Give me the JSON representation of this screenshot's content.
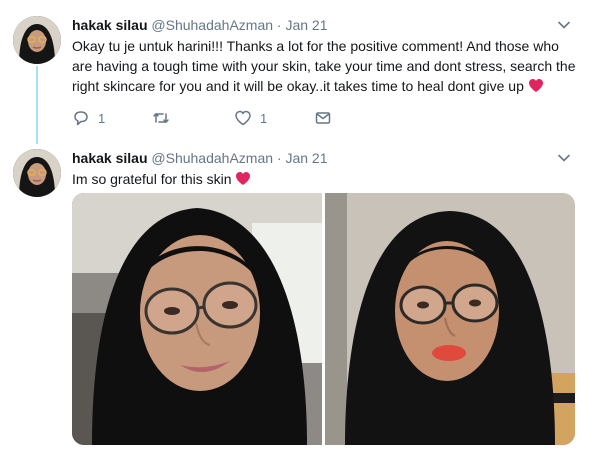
{
  "tweets": [
    {
      "name": "hakak silau",
      "handle": "@ShuhadahAzman",
      "separator": "·",
      "time": "Jan 21",
      "text": "Okay tu je untuk harini!!! Thanks a lot for the positive comment! And those who are having a tough time with your skin, take your time and dont stress, search the right skincare for you and it will be okay..it takes time to heal dont give up",
      "emoji": "red-heart",
      "actions": {
        "reply_count": "1",
        "retweet_count": "",
        "like_count": "1"
      }
    },
    {
      "name": "hakak silau",
      "handle": "@ShuhadahAzman",
      "separator": "·",
      "time": "Jan 21",
      "text": "Im so grateful for this skin",
      "emoji": "red-heart"
    }
  ],
  "colors": {
    "accent_thread": "#a8e0f6",
    "heart": "#e0245e",
    "muted": "#657786",
    "text": "#14171a"
  },
  "icons": [
    "chevron-down-icon",
    "reply-icon",
    "retweet-icon",
    "like-icon",
    "direct-message-icon",
    "heart-emoji-icon"
  ]
}
